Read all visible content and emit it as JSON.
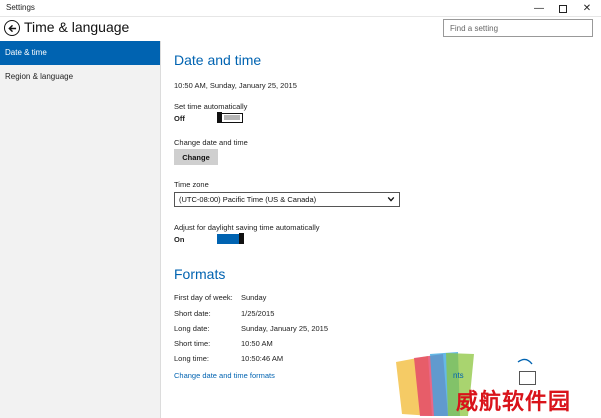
{
  "window": {
    "title": "Settings",
    "controls": {
      "minimize": "—",
      "close": "✕"
    }
  },
  "header": {
    "title": "Time & language",
    "search_placeholder": "Find a setting"
  },
  "sidebar": {
    "items": [
      {
        "label": "Date & time",
        "active": true
      },
      {
        "label": "Region & language",
        "active": false
      }
    ]
  },
  "date_time": {
    "heading": "Date and time",
    "current": "10:50 AM, Sunday, January 25, 2015",
    "set_auto_label": "Set time automatically",
    "set_auto_state": "Off",
    "change_label": "Change date and time",
    "change_button": "Change",
    "timezone_label": "Time zone",
    "timezone_value": "(UTC-08:00) Pacific Time (US & Canada)",
    "dst_label": "Adjust for daylight saving time automatically",
    "dst_state": "On"
  },
  "formats": {
    "heading": "Formats",
    "rows": [
      {
        "label": "First day of week:",
        "value": "Sunday"
      },
      {
        "label": "Short date:",
        "value": "1/25/2015"
      },
      {
        "label": "Long date:",
        "value": "Sunday, January 25, 2015"
      },
      {
        "label": "Short time:",
        "value": "10:50 AM"
      },
      {
        "label": "Long time:",
        "value": "10:50:46 AM"
      }
    ],
    "link": "Change date and time formats"
  },
  "watermark": {
    "text": "威航软件园",
    "fragment": "nts"
  },
  "colors": {
    "accent": "#0063b1",
    "sidebar_bg": "#f2f2f2",
    "watermark_red": "#d9131a"
  }
}
